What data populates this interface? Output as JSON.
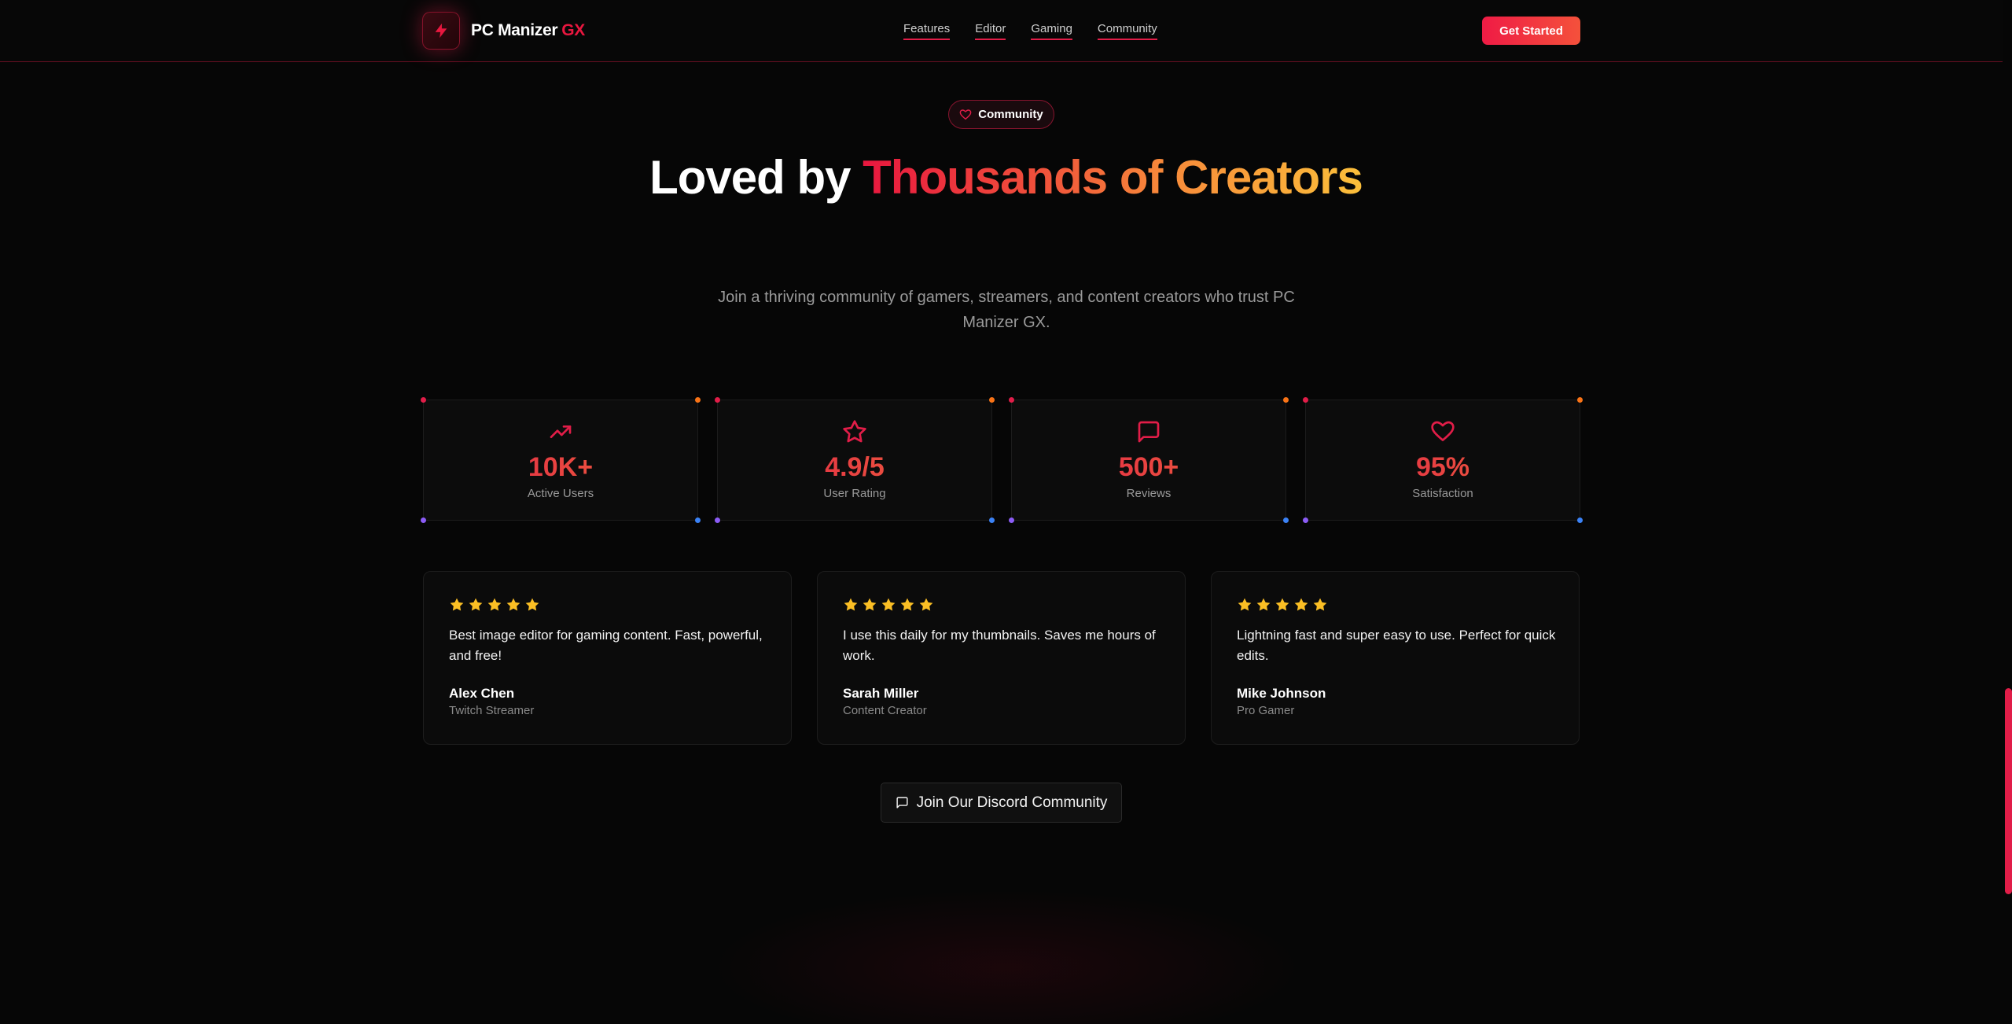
{
  "nav": {
    "brand_name": "PC Manizer",
    "brand_accent": "GX",
    "links": [
      "Features",
      "Editor",
      "Gaming",
      "Community"
    ],
    "cta": "Get Started"
  },
  "hero": {
    "badge": "Community",
    "title_white": "Loved by",
    "title_gradient": "Thousands of Creators",
    "subtitle": "Join a thriving community of gamers, streamers, and content creators who trust PC Manizer GX."
  },
  "stats": [
    {
      "icon": "trending-up-icon",
      "value": "10K+",
      "label": "Active Users"
    },
    {
      "icon": "star-icon",
      "value": "4.9/5",
      "label": "User Rating"
    },
    {
      "icon": "message-square-icon",
      "value": "500+",
      "label": "Reviews"
    },
    {
      "icon": "heart-icon",
      "value": "95%",
      "label": "Satisfaction"
    }
  ],
  "testimonials": [
    {
      "rating": 5,
      "quote": "Best image editor for gaming content. Fast, powerful, and free!",
      "name": "Alex Chen",
      "role": "Twitch Streamer"
    },
    {
      "rating": 5,
      "quote": "I use this daily for my thumbnails. Saves me hours of work.",
      "name": "Sarah Miller",
      "role": "Content Creator"
    },
    {
      "rating": 5,
      "quote": "Lightning fast and super easy to use. Perfect for quick edits.",
      "name": "Mike Johnson",
      "role": "Pro Gamer"
    }
  ],
  "discord_button": "Join Our Discord Community",
  "colors": {
    "accent": "#e11d48",
    "accent_orange": "#f97316",
    "star": "#fbbf24",
    "background": "#060606"
  }
}
